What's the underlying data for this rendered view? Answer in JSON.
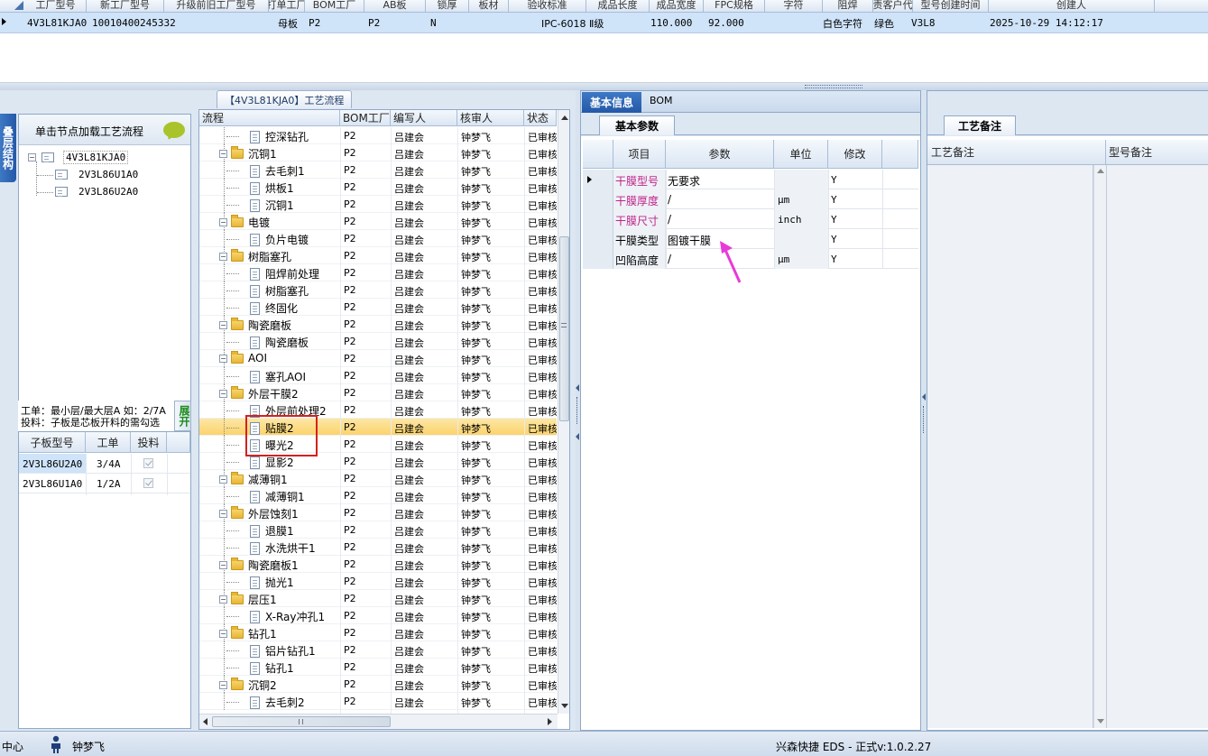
{
  "top_grid": {
    "headers": [
      "工厂型号",
      "新工厂型号",
      "升级前旧工厂型号",
      "打单工厂",
      "BOM工厂",
      "AB板",
      "锁厚",
      "板材",
      "验收标准",
      "成品长度",
      "成品宽度",
      "FPC规格",
      "字符",
      "阻焊",
      "负责客户代码",
      "型号创建时间",
      "创建人"
    ],
    "row": {
      "model": "4V3L81KJA0",
      "code": "10010400245332",
      "board": "母板",
      "factory1": "P2",
      "factory2": "P2",
      "ab": "N",
      "standard": "IPC-6018 Ⅱ级",
      "length": "110.000",
      "width": "92.000",
      "char": "白色字符",
      "mask": "绿色",
      "customer": "V3L8",
      "created": "2025-10-29 14:12:17"
    }
  },
  "left_panel": {
    "side_tab": "叠层结构",
    "load_hint": "单击节点加载工艺流程",
    "tree_root": "4V3L81KJA0",
    "tree_children": [
      "2V3L86U1A0",
      "2V3L86U2A0"
    ],
    "note_line1": "工单：最小层/最大层A 如：2/7A",
    "note_line2": "投料：子板是芯板开料的需勾选",
    "expand_button": "展开",
    "sub_headers": [
      "子板型号",
      "工单",
      "投料"
    ],
    "sub_rows": [
      {
        "model": "2V3L86U2A0",
        "order": "3/4A"
      },
      {
        "model": "2V3L86U1A0",
        "order": "1/2A"
      }
    ]
  },
  "flow_panel": {
    "title": "【4V3L81KJA0】工艺流程",
    "headers": [
      "流程",
      "BOM工厂",
      "编写人",
      "核审人",
      "状态"
    ],
    "rows": [
      {
        "t": "doc",
        "name": "控深钻孔",
        "f": "P2",
        "w": "吕建会",
        "r": "钟梦飞",
        "s": "已审核"
      },
      {
        "t": "folder",
        "name": "沉铜1",
        "f": "P2",
        "w": "吕建会",
        "r": "钟梦飞",
        "s": "已审核"
      },
      {
        "t": "doc",
        "name": "去毛刺1",
        "f": "P2",
        "w": "吕建会",
        "r": "钟梦飞",
        "s": "已审核"
      },
      {
        "t": "doc",
        "name": "烘板1",
        "f": "P2",
        "w": "吕建会",
        "r": "钟梦飞",
        "s": "已审核"
      },
      {
        "t": "doc",
        "name": "沉铜1",
        "f": "P2",
        "w": "吕建会",
        "r": "钟梦飞",
        "s": "已审核"
      },
      {
        "t": "folder",
        "name": "电镀",
        "f": "P2",
        "w": "吕建会",
        "r": "钟梦飞",
        "s": "已审核"
      },
      {
        "t": "doc",
        "name": "负片电镀",
        "f": "P2",
        "w": "吕建会",
        "r": "钟梦飞",
        "s": "已审核"
      },
      {
        "t": "folder",
        "name": "树脂塞孔",
        "f": "P2",
        "w": "吕建会",
        "r": "钟梦飞",
        "s": "已审核"
      },
      {
        "t": "doc",
        "name": "阻焊前处理",
        "f": "P2",
        "w": "吕建会",
        "r": "钟梦飞",
        "s": "已审核"
      },
      {
        "t": "doc",
        "name": "树脂塞孔",
        "f": "P2",
        "w": "吕建会",
        "r": "钟梦飞",
        "s": "已审核"
      },
      {
        "t": "doc",
        "name": "终固化",
        "f": "P2",
        "w": "吕建会",
        "r": "钟梦飞",
        "s": "已审核"
      },
      {
        "t": "folder",
        "name": "陶瓷磨板",
        "f": "P2",
        "w": "吕建会",
        "r": "钟梦飞",
        "s": "已审核"
      },
      {
        "t": "doc",
        "name": "陶瓷磨板",
        "f": "P2",
        "w": "吕建会",
        "r": "钟梦飞",
        "s": "已审核"
      },
      {
        "t": "folder",
        "name": "AOI",
        "f": "P2",
        "w": "吕建会",
        "r": "钟梦飞",
        "s": "已审核"
      },
      {
        "t": "doc",
        "name": "塞孔AOI",
        "f": "P2",
        "w": "吕建会",
        "r": "钟梦飞",
        "s": "已审核"
      },
      {
        "t": "folder",
        "name": "外层干膜2",
        "f": "P2",
        "w": "吕建会",
        "r": "钟梦飞",
        "s": "已审核"
      },
      {
        "t": "doc",
        "name": "外层前处理2",
        "f": "P2",
        "w": "吕建会",
        "r": "钟梦飞",
        "s": "已审核"
      },
      {
        "t": "doc",
        "name": "贴膜2",
        "f": "P2",
        "w": "吕建会",
        "r": "钟梦飞",
        "s": "已审核",
        "sel": true
      },
      {
        "t": "doc",
        "name": "曝光2",
        "f": "P2",
        "w": "吕建会",
        "r": "钟梦飞",
        "s": "已审核"
      },
      {
        "t": "doc",
        "name": "显影2",
        "f": "P2",
        "w": "吕建会",
        "r": "钟梦飞",
        "s": "已审核"
      },
      {
        "t": "folder",
        "name": "减薄铜1",
        "f": "P2",
        "w": "吕建会",
        "r": "钟梦飞",
        "s": "已审核"
      },
      {
        "t": "doc",
        "name": "减薄铜1",
        "f": "P2",
        "w": "吕建会",
        "r": "钟梦飞",
        "s": "已审核"
      },
      {
        "t": "folder",
        "name": "外层蚀刻1",
        "f": "P2",
        "w": "吕建会",
        "r": "钟梦飞",
        "s": "已审核"
      },
      {
        "t": "doc",
        "name": "退膜1",
        "f": "P2",
        "w": "吕建会",
        "r": "钟梦飞",
        "s": "已审核"
      },
      {
        "t": "doc",
        "name": "水洗烘干1",
        "f": "P2",
        "w": "吕建会",
        "r": "钟梦飞",
        "s": "已审核"
      },
      {
        "t": "folder",
        "name": "陶瓷磨板1",
        "f": "P2",
        "w": "吕建会",
        "r": "钟梦飞",
        "s": "已审核"
      },
      {
        "t": "doc",
        "name": "抛光1",
        "f": "P2",
        "w": "吕建会",
        "r": "钟梦飞",
        "s": "已审核"
      },
      {
        "t": "folder",
        "name": "层压1",
        "f": "P2",
        "w": "吕建会",
        "r": "钟梦飞",
        "s": "已审核"
      },
      {
        "t": "doc",
        "name": "X-Ray冲孔1",
        "f": "P2",
        "w": "吕建会",
        "r": "钟梦飞",
        "s": "已审核"
      },
      {
        "t": "folder",
        "name": "钻孔1",
        "f": "P2",
        "w": "吕建会",
        "r": "钟梦飞",
        "s": "已审核"
      },
      {
        "t": "doc",
        "name": "铝片钻孔1",
        "f": "P2",
        "w": "吕建会",
        "r": "钟梦飞",
        "s": "已审核"
      },
      {
        "t": "doc",
        "name": "钻孔1",
        "f": "P2",
        "w": "吕建会",
        "r": "钟梦飞",
        "s": "已审核"
      },
      {
        "t": "folder",
        "name": "沉铜2",
        "f": "P2",
        "w": "吕建会",
        "r": "钟梦飞",
        "s": "已审核"
      },
      {
        "t": "doc",
        "name": "去毛刺2",
        "f": "P2",
        "w": "吕建会",
        "r": "钟梦飞",
        "s": "已审核"
      }
    ]
  },
  "info_panel": {
    "tabs": [
      "基本信息",
      "BOM"
    ],
    "sub_tab": "基本参数",
    "headers": [
      "项目",
      "参数",
      "单位",
      "修改"
    ],
    "rows": [
      {
        "item": "干膜型号",
        "param": "无要求",
        "unit": "",
        "mod": "Y",
        "pink": true
      },
      {
        "item": "干膜厚度",
        "param": "/",
        "unit": "μm",
        "mod": "Y",
        "pink": true
      },
      {
        "item": "干膜尺寸",
        "param": "/",
        "unit": "inch",
        "mod": "Y",
        "pink": true
      },
      {
        "item": "干膜类型",
        "param": "图镀干膜",
        "unit": "",
        "mod": "Y",
        "pink": false
      },
      {
        "item": "凹陷高度",
        "param": "/",
        "unit": "μm",
        "mod": "Y",
        "pink": false
      }
    ]
  },
  "remark_panel": {
    "tab": "工艺备注",
    "col1": "工艺备注",
    "col2": "型号备注"
  },
  "status_bar": {
    "left": "中心",
    "user": "钟梦飞",
    "version": "兴森快捷 EDS - 正式v:1.0.2.27"
  },
  "colors": {
    "selected_row": "#fbd36b",
    "pink_text": "#c0248a",
    "highlight_box": "#d42020",
    "arrow": "#e83ad8",
    "accent": "#2458a8"
  }
}
